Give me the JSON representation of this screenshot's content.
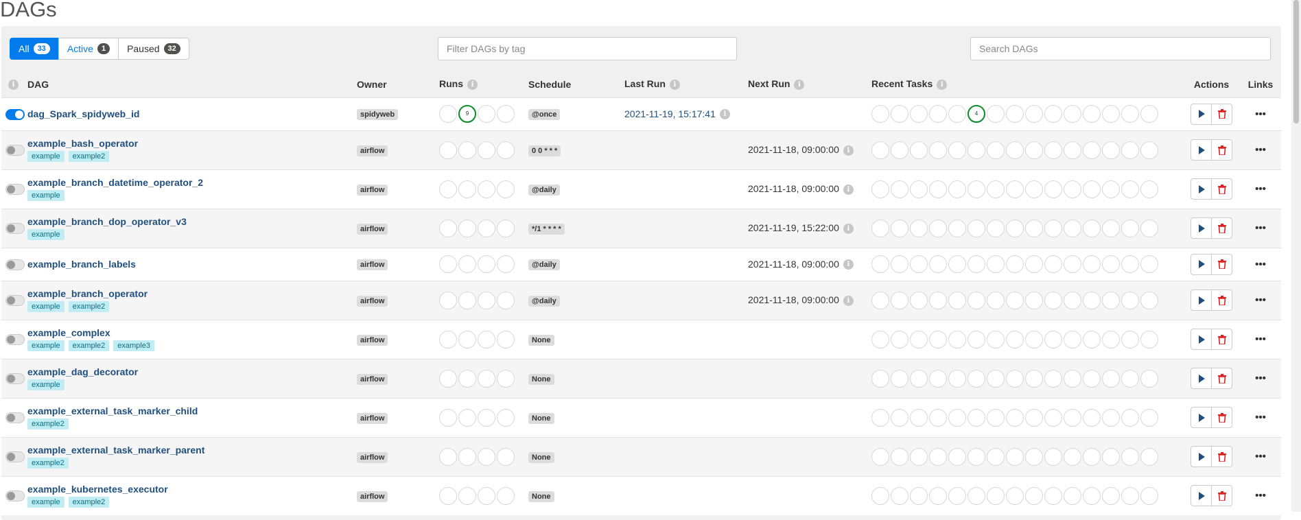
{
  "page": {
    "title": "DAGs"
  },
  "filters": [
    {
      "label": "All",
      "count": "33"
    },
    {
      "label": "Active",
      "count": "1"
    },
    {
      "label": "Paused",
      "count": "32"
    }
  ],
  "tag_filter": {
    "placeholder": "Filter DAGs by tag",
    "value": ""
  },
  "search": {
    "placeholder": "Search DAGs",
    "value": ""
  },
  "columns": {
    "dag": "DAG",
    "owner": "Owner",
    "runs": "Runs",
    "schedule": "Schedule",
    "last_run": "Last Run",
    "next_run": "Next Run",
    "recent_tasks": "Recent Tasks",
    "actions": "Actions",
    "links": "Links"
  },
  "info_glyph": "i",
  "links_glyph": "•••",
  "colors": {
    "accent": "#017cee",
    "dag_link": "#1f4f7e",
    "tag_bg": "#c0ecf3",
    "success": "#0a8c2a",
    "delete": "#e02020"
  },
  "icons": {
    "trigger": "play-icon",
    "delete": "trash-icon",
    "info": "info-icon",
    "links": "more-horizontal-icon"
  },
  "dags": [
    {
      "name": "dag_Spark_spidyweb_id",
      "active": true,
      "tags": [],
      "owner": "spidyweb",
      "runs": [
        "",
        "9",
        "",
        ""
      ],
      "schedule": "@once",
      "last_run": "2021-11-19, 15:17:41",
      "next_run": "",
      "recent_tasks_marks": {
        "5": "4"
      }
    },
    {
      "name": "example_bash_operator",
      "active": false,
      "tags": [
        "example",
        "example2"
      ],
      "owner": "airflow",
      "runs": [
        "",
        "",
        "",
        ""
      ],
      "schedule": "0 0 * * *",
      "last_run": "",
      "next_run": "2021-11-18, 09:00:00",
      "recent_tasks_marks": {}
    },
    {
      "name": "example_branch_datetime_operator_2",
      "active": false,
      "tags": [
        "example"
      ],
      "owner": "airflow",
      "runs": [
        "",
        "",
        "",
        ""
      ],
      "schedule": "@daily",
      "last_run": "",
      "next_run": "2021-11-18, 09:00:00",
      "recent_tasks_marks": {}
    },
    {
      "name": "example_branch_dop_operator_v3",
      "active": false,
      "tags": [
        "example"
      ],
      "owner": "airflow",
      "runs": [
        "",
        "",
        "",
        ""
      ],
      "schedule": "*/1 * * * *",
      "last_run": "",
      "next_run": "2021-11-19, 15:22:00",
      "recent_tasks_marks": {}
    },
    {
      "name": "example_branch_labels",
      "active": false,
      "tags": [],
      "owner": "airflow",
      "runs": [
        "",
        "",
        "",
        ""
      ],
      "schedule": "@daily",
      "last_run": "",
      "next_run": "2021-11-18, 09:00:00",
      "recent_tasks_marks": {}
    },
    {
      "name": "example_branch_operator",
      "active": false,
      "tags": [
        "example",
        "example2"
      ],
      "owner": "airflow",
      "runs": [
        "",
        "",
        "",
        ""
      ],
      "schedule": "@daily",
      "last_run": "",
      "next_run": "2021-11-18, 09:00:00",
      "recent_tasks_marks": {}
    },
    {
      "name": "example_complex",
      "active": false,
      "tags": [
        "example",
        "example2",
        "example3"
      ],
      "owner": "airflow",
      "runs": [
        "",
        "",
        "",
        ""
      ],
      "schedule": "None",
      "last_run": "",
      "next_run": "",
      "recent_tasks_marks": {}
    },
    {
      "name": "example_dag_decorator",
      "active": false,
      "tags": [
        "example"
      ],
      "owner": "airflow",
      "runs": [
        "",
        "",
        "",
        ""
      ],
      "schedule": "None",
      "last_run": "",
      "next_run": "",
      "recent_tasks_marks": {}
    },
    {
      "name": "example_external_task_marker_child",
      "active": false,
      "tags": [
        "example2"
      ],
      "owner": "airflow",
      "runs": [
        "",
        "",
        "",
        ""
      ],
      "schedule": "None",
      "last_run": "",
      "next_run": "",
      "recent_tasks_marks": {}
    },
    {
      "name": "example_external_task_marker_parent",
      "active": false,
      "tags": [
        "example2"
      ],
      "owner": "airflow",
      "runs": [
        "",
        "",
        "",
        ""
      ],
      "schedule": "None",
      "last_run": "",
      "next_run": "",
      "recent_tasks_marks": {}
    },
    {
      "name": "example_kubernetes_executor",
      "active": false,
      "tags": [
        "example",
        "example2"
      ],
      "owner": "airflow",
      "runs": [
        "",
        "",
        "",
        ""
      ],
      "schedule": "None",
      "last_run": "",
      "next_run": "",
      "recent_tasks_marks": {}
    }
  ]
}
